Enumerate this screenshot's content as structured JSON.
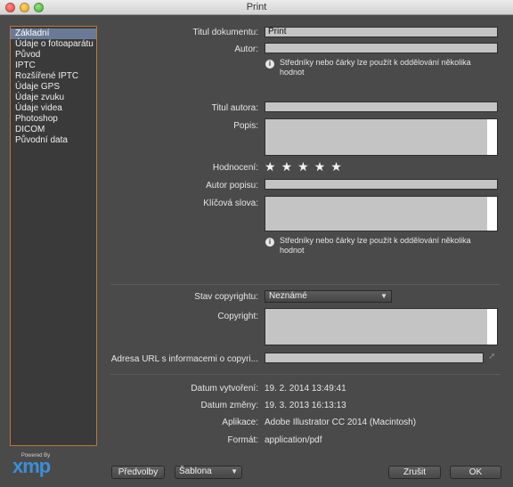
{
  "window": {
    "title": "Print"
  },
  "sidebar": {
    "items": [
      {
        "label": "Základní",
        "selected": true
      },
      {
        "label": "Údaje o fotoaparátu"
      },
      {
        "label": "Původ"
      },
      {
        "label": "IPTC"
      },
      {
        "label": "Rozšířené IPTC"
      },
      {
        "label": "Údaje GPS"
      },
      {
        "label": "Údaje zvuku"
      },
      {
        "label": "Údaje videa"
      },
      {
        "label": "Photoshop"
      },
      {
        "label": "DICOM"
      },
      {
        "label": "Původní data"
      }
    ]
  },
  "branding": {
    "powered_by": "Powered By",
    "logo": "xmp",
    "logo_color": "#3a8fd6"
  },
  "form": {
    "title_label": "Titul dokumentu:",
    "title_value": "Print",
    "author_label": "Autor:",
    "author_value": "",
    "separator_hint": "Středníky nebo čárky lze použít k oddělování několika hodnot",
    "author_title_label": "Titul autora:",
    "author_title_value": "",
    "description_label": "Popis:",
    "description_value": "",
    "rating_label": "Hodnocení:",
    "rating_value": 0,
    "rating_max": 5,
    "description_author_label": "Autor popisu:",
    "description_author_value": "",
    "keywords_label": "Klíčová slova:",
    "keywords_value": "",
    "keywords_hint": "Středníky nebo čárky lze použít k oddělování několika hodnot",
    "copyright_status_label": "Stav copyrightu:",
    "copyright_status_value": "Neznámé",
    "copyright_label": "Copyright:",
    "copyright_value": "",
    "copyright_url_label": "Adresa URL s informacemi o copyri...",
    "copyright_url_value": ""
  },
  "metadata": {
    "created_label": "Datum vytvoření:",
    "created_value": "19. 2. 2014 13:49:41",
    "modified_label": "Datum změny:",
    "modified_value": "19. 3. 2013 16:13:13",
    "app_label": "Aplikace:",
    "app_value": "Adobe Illustrator CC 2014 (Macintosh)",
    "format_label": "Formát:",
    "format_value": "application/pdf"
  },
  "footer": {
    "preferences_label": "Předvolby",
    "template_label": "Šablona",
    "cancel_label": "Zrušit",
    "ok_label": "OK"
  },
  "colors": {
    "selection": "#6a7a96",
    "sidebar_border": "#b77a3a",
    "background": "#4a4a4a"
  }
}
